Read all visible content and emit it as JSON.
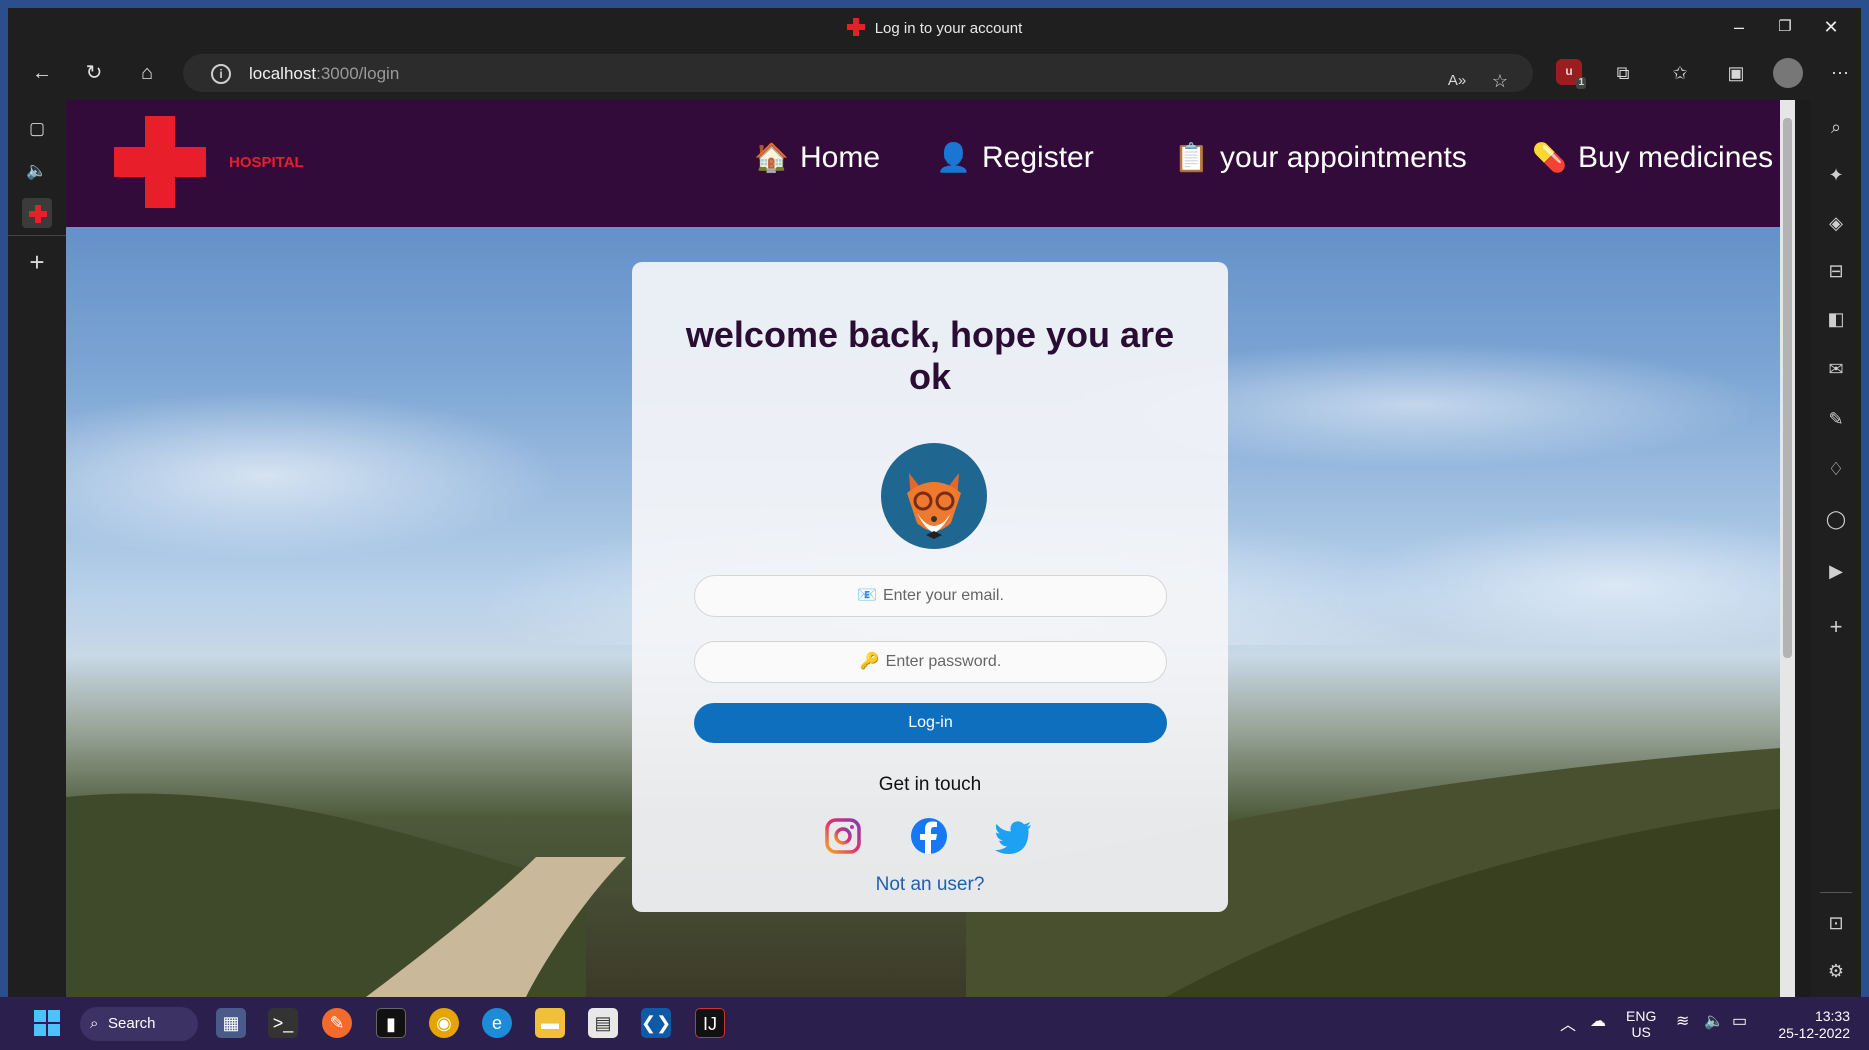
{
  "browser": {
    "tab_title": "Log in to your account",
    "url_host": "localhost",
    "url_path": ":3000/login",
    "extension_badge": "1"
  },
  "site": {
    "logo_text": "HOSPITAL",
    "nav": [
      {
        "label": "Home",
        "icon": "house-icon",
        "emoji": "🏠"
      },
      {
        "label": "Register",
        "icon": "user-icon",
        "emoji": "👤"
      },
      {
        "label": "your appointments",
        "icon": "clipboard-icon",
        "emoji": "📋"
      },
      {
        "label": "Buy medicines",
        "icon": "pill-icon",
        "emoji": "💊"
      }
    ],
    "colors": {
      "header_bg": "#330b3b",
      "logo_red": "#e81f2a",
      "button_blue": "#0f6fbf"
    }
  },
  "login": {
    "heading": "welcome back, hope you are ok",
    "email_placeholder": "Enter your email.",
    "email_icon": "📧",
    "password_placeholder": "Enter password.",
    "password_icon": "🔑",
    "login_label": "Log-in",
    "get_in_touch": "Get in touch",
    "social": [
      "instagram-icon",
      "facebook-icon",
      "twitter-icon"
    ],
    "not_user": "Not an user?"
  },
  "taskbar": {
    "search_label": "Search",
    "lang_top": "ENG",
    "lang_bottom": "US",
    "time": "13:33",
    "date": "25-12-2022"
  }
}
